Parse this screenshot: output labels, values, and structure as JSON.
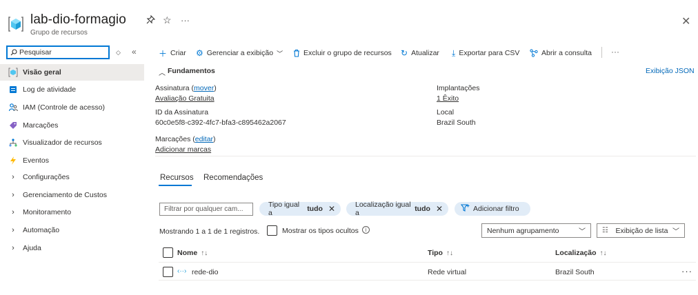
{
  "header": {
    "title": "lab-dio-formagio",
    "subtitle": "Grupo de recursos",
    "more": "···",
    "close": "✕"
  },
  "sidebar": {
    "search_placeholder": "Pesquisar",
    "items": [
      {
        "label": "Visão geral",
        "icon": "resource-group-icon",
        "active": true
      },
      {
        "label": "Log de atividade",
        "icon": "activity-log-icon"
      },
      {
        "label": "IAM (Controle de acesso)",
        "icon": "iam-people-icon"
      },
      {
        "label": "Marcações",
        "icon": "tag-icon"
      },
      {
        "label": "Visualizador de recursos",
        "icon": "resource-visualizer-icon"
      },
      {
        "label": "Eventos",
        "icon": "events-bolt-icon"
      },
      {
        "label": "Configurações",
        "icon": "chevron-right-icon"
      },
      {
        "label": "Gerenciamento de Custos",
        "icon": "chevron-right-icon"
      },
      {
        "label": "Monitoramento",
        "icon": "chevron-right-icon"
      },
      {
        "label": "Automação",
        "icon": "chevron-right-icon"
      },
      {
        "label": "Ajuda",
        "icon": "chevron-right-icon"
      }
    ]
  },
  "toolbar": {
    "create": "Criar",
    "manage_view": "Gerenciar a exibição",
    "delete_group": "Excluir o grupo de recursos",
    "refresh": "Atualizar",
    "export_csv": "Exportar para CSV",
    "open_query": "Abrir a consulta",
    "more": "···"
  },
  "essentials": {
    "title": "Fundamentos",
    "json_view": "Exibição JSON",
    "subscription_label": "Assinatura (",
    "subscription_move": "mover",
    "subscription_label_end": ")",
    "subscription_value": "Avaliação Gratuita",
    "subscription_id_label": "ID da Assinatura",
    "subscription_id_value": "60c0e5f8-c392-4fc7-bfa3-c895462a2067",
    "tags_label": "Marcações (",
    "tags_edit": "editar",
    "tags_label_end": ")",
    "tags_add": "Adicionar marcas",
    "deployments_label": "Implantações",
    "deployments_value": "1 Êxito",
    "location_label": "Local",
    "location_value": "Brazil South"
  },
  "tabs": {
    "resources": "Recursos",
    "recommendations": "Recomendações"
  },
  "filters": {
    "placeholder": "Filtrar por qualquer cam...",
    "type_prefix": "Tipo igual a",
    "type_value": "tudo",
    "location_prefix": "Localização igual a",
    "location_value": "tudo",
    "add_filter": "Adicionar filtro"
  },
  "list": {
    "showing": "Mostrando 1 a 1 de 1 registros.",
    "show_hidden": "Mostrar os tipos ocultos",
    "grouping": "Nenhum agrupamento",
    "view_mode": "Exibição de lista",
    "columns": {
      "name": "Nome",
      "type": "Tipo",
      "location": "Localização"
    },
    "rows": [
      {
        "name": "rede-dio",
        "type": "Rede virtual",
        "location": "Brazil South"
      }
    ]
  },
  "colors": {
    "accent": "#0078d4",
    "link": "#0067b8",
    "pill": "#e1ecf7",
    "active_nav": "#edebe9"
  }
}
